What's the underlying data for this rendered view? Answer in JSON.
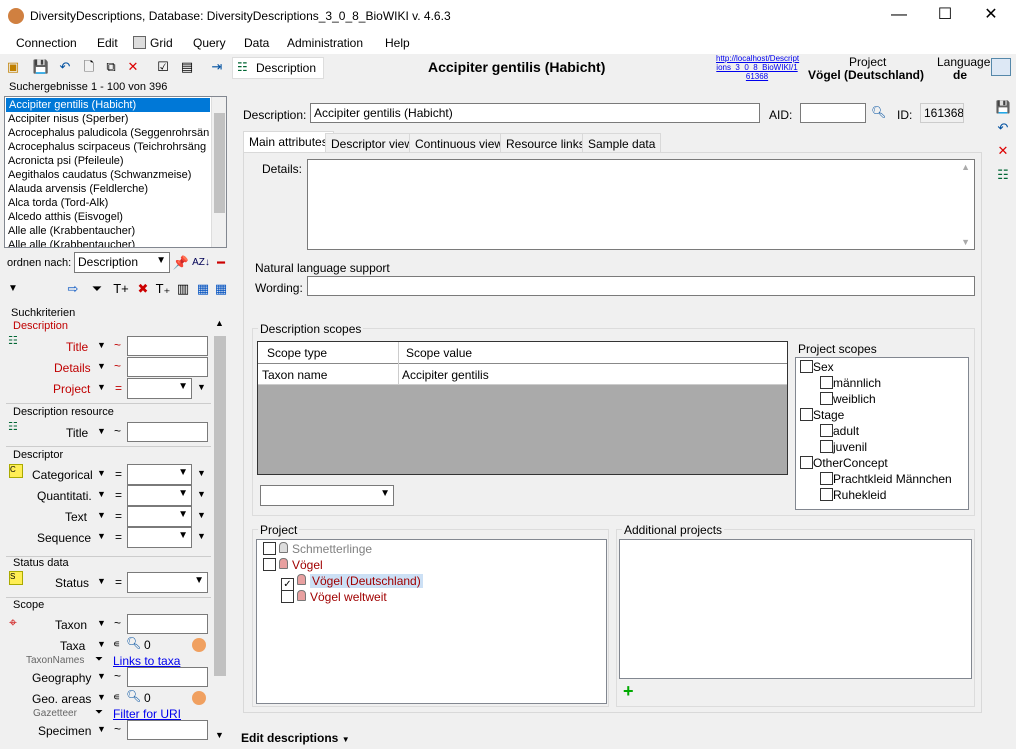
{
  "window": {
    "title": "DiversityDescriptions,  Database: DiversityDescriptions_3_0_8_BioWIKI    v. 4.6.3",
    "minimize": "—",
    "maximize": "☐",
    "close": "✕"
  },
  "menu": [
    "Connection",
    "Edit",
    "Grid",
    "Query",
    "Data",
    "Administration",
    "Help"
  ],
  "toolbar": {
    "description_button": "Description",
    "header_title": "Accipiter gentilis (Habicht)",
    "link_text": "http://localhost/Descript ions_3_0_8_BioWIKI/1 61368",
    "project_label": "Project",
    "project_value": "Vögel (Deutschland)",
    "language_label": "Language",
    "language_value": "de"
  },
  "results": {
    "header": "Suchergebnisse   1 - 100 von 396",
    "items": [
      "Accipiter gentilis (Habicht)",
      "Accipiter nisus (Sperber)",
      "Acrocephalus paludicola (Seggenrohrsän",
      "Acrocephalus scirpaceus (Teichrohrsäng",
      "Acronicta psi (Pfeileule)",
      "Aegithalos caudatus (Schwanzmeise)",
      "Alauda arvensis (Feldlerche)",
      "Alca torda (Tord-Alk)",
      "Alcedo atthis (Eisvogel)",
      "Alle alle (Krabbentaucher)",
      "Alle alle (Krabbentaucher)"
    ],
    "sort_label": "ordnen nach:",
    "sort_value": "Description"
  },
  "search": {
    "header": "Suchkriterien",
    "description_section": "Description",
    "title": "Title",
    "details": "Details",
    "project": "Project",
    "desc_resource": "Description resource",
    "res_title": "Title",
    "descriptor": "Descriptor",
    "categorical": "Categorical",
    "quantitative": "Quantitati.",
    "text": "Text",
    "sequence": "Sequence",
    "status_data": "Status data",
    "status": "Status",
    "scope": "Scope",
    "taxon": "Taxon",
    "taxa": "Taxa",
    "taxon_names": "TaxonNames",
    "links_to_taxa": "Links to taxa",
    "geography": "Geography",
    "geo_areas": "Geo. areas",
    "gazetteer": "Gazetteer",
    "filter_for_uri": "Filter for URI",
    "specimen": "Specimen",
    "tilde": "~",
    "equals": "=",
    "zero": "0",
    "in": "∊"
  },
  "form": {
    "description_label": "Description:",
    "description_value": "Accipiter gentilis (Habicht)",
    "aid_label": "AID:",
    "aid_value": "",
    "id_label": "ID:",
    "id_value": "161368"
  },
  "tabs": [
    "Main attributes",
    "Descriptor view",
    "Continuous view",
    "Resource links",
    "Sample data"
  ],
  "main": {
    "details_label": "Details:",
    "nls_label": "Natural language support",
    "wording_label": "Wording:",
    "desc_scopes": "Description scopes",
    "scope_type_col": "Scope type",
    "scope_value_col": "Scope value",
    "scope_rows": [
      {
        "type": "Taxon name",
        "value": "Accipiter gentilis"
      }
    ],
    "project_scopes": "Project scopes",
    "tree": [
      {
        "label": "Sex",
        "level": 0
      },
      {
        "label": "männlich",
        "level": 1
      },
      {
        "label": "weiblich",
        "level": 1
      },
      {
        "label": "Stage",
        "level": 0
      },
      {
        "label": "adult",
        "level": 1
      },
      {
        "label": "juvenil",
        "level": 1
      },
      {
        "label": "OtherConcept",
        "level": 0
      },
      {
        "label": "Prachtkleid Männchen",
        "level": 1
      },
      {
        "label": "Ruhekleid",
        "level": 1
      }
    ],
    "project_header": "Project",
    "projects": [
      {
        "label": "Schmetterlinge",
        "level": 0,
        "checked": false,
        "color": "#808080"
      },
      {
        "label": "Vögel",
        "level": 0,
        "checked": false,
        "color": "#a00000"
      },
      {
        "label": "Vögel (Deutschland)",
        "level": 1,
        "checked": true,
        "color": "#a00000"
      },
      {
        "label": "Vögel weltweit",
        "level": 1,
        "checked": false,
        "color": "#a00000"
      }
    ],
    "additional_projects": "Additional projects"
  },
  "footer": {
    "edit_descriptions": "Edit descriptions"
  }
}
